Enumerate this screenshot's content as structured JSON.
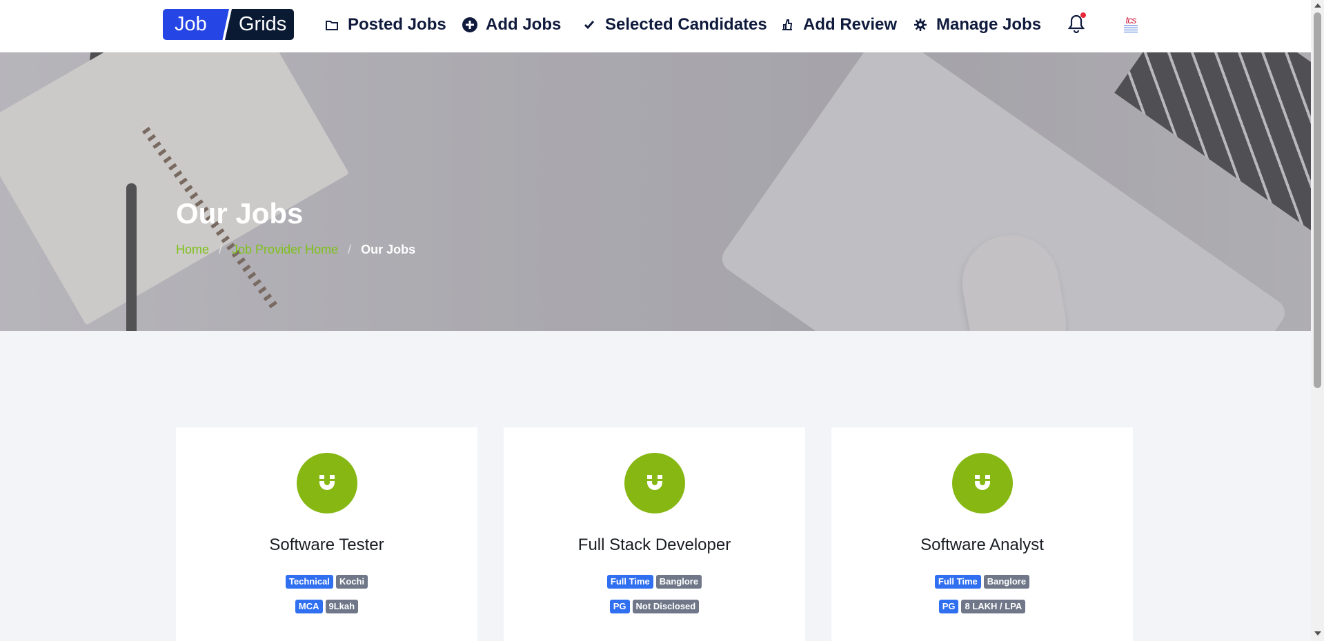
{
  "brand": {
    "part1": "Job",
    "part2": "Grids"
  },
  "nav": {
    "posted_jobs": "Posted Jobs",
    "add_jobs": "Add Jobs",
    "selected_candidates": "Selected Candidates",
    "add_review": "Add Review",
    "manage_jobs": "Manage Jobs"
  },
  "company_logo_text": "tcs",
  "hero": {
    "title": "Our Jobs",
    "breadcrumb": {
      "home": "Home",
      "provider_home": "Job Provider Home",
      "current": "Our Jobs"
    }
  },
  "jobs": [
    {
      "title": "Software Tester",
      "tags_row1": [
        "Technical",
        "Kochi"
      ],
      "tags_row2": [
        "MCA",
        "9Lkah"
      ]
    },
    {
      "title": "Full Stack Developer",
      "tags_row1": [
        "Full Time",
        "Banglore"
      ],
      "tags_row2": [
        "PG",
        "Not Disclosed"
      ]
    },
    {
      "title": "Software Analyst",
      "tags_row1": [
        "Full Time",
        "Banglore"
      ],
      "tags_row2": [
        "PG",
        "8 LAKH / LPA"
      ]
    }
  ],
  "colors": {
    "brand_blue": "#2546e4",
    "brand_dark": "#0a1a33",
    "accent_green": "#86b713",
    "link_green": "#7ec11a",
    "tag_blue": "#2f6ff0",
    "tag_gray": "#6f7788"
  },
  "icons": {
    "posted_jobs": "folder-icon",
    "add_jobs": "plus-circle-icon",
    "selected_candidates": "check-icon",
    "add_review": "thumbs-up-icon",
    "manage_jobs": "gear-icon",
    "notifications": "bell-icon",
    "job_card": "magnet-icon"
  }
}
